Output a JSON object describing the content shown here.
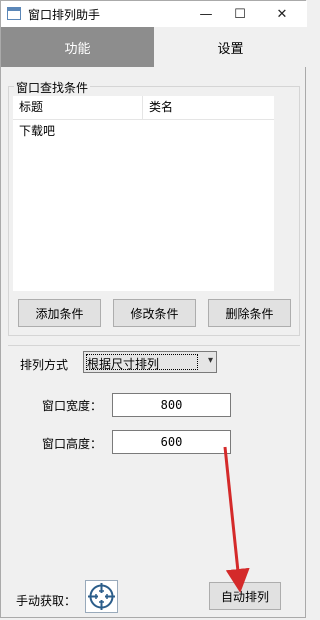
{
  "window": {
    "title": "窗口排列助手"
  },
  "controls": {
    "minimize": "—",
    "maximize": "☐",
    "close": "✕"
  },
  "tabs": [
    {
      "label": "功能",
      "active": true
    },
    {
      "label": "设置",
      "active": false
    }
  ],
  "find_group": {
    "title": "窗口查找条件",
    "columns": [
      "标题",
      "类名"
    ],
    "rows": [
      [
        "下载吧",
        ""
      ]
    ],
    "buttons": {
      "add": "添加条件",
      "edit": "修改条件",
      "delete": "删除条件"
    }
  },
  "arrange": {
    "mode_label": "排列方式",
    "mode_value": "根据尺寸排列",
    "width_label": "窗口宽度：",
    "width_value": "800",
    "height_label": "窗口高度：",
    "height_value": "600"
  },
  "footer": {
    "manual_label": "手动获取：",
    "grab_icon": "crosshair-icon",
    "auto_button": "自动排列"
  },
  "annotation": {
    "color": "#d42a2a"
  }
}
